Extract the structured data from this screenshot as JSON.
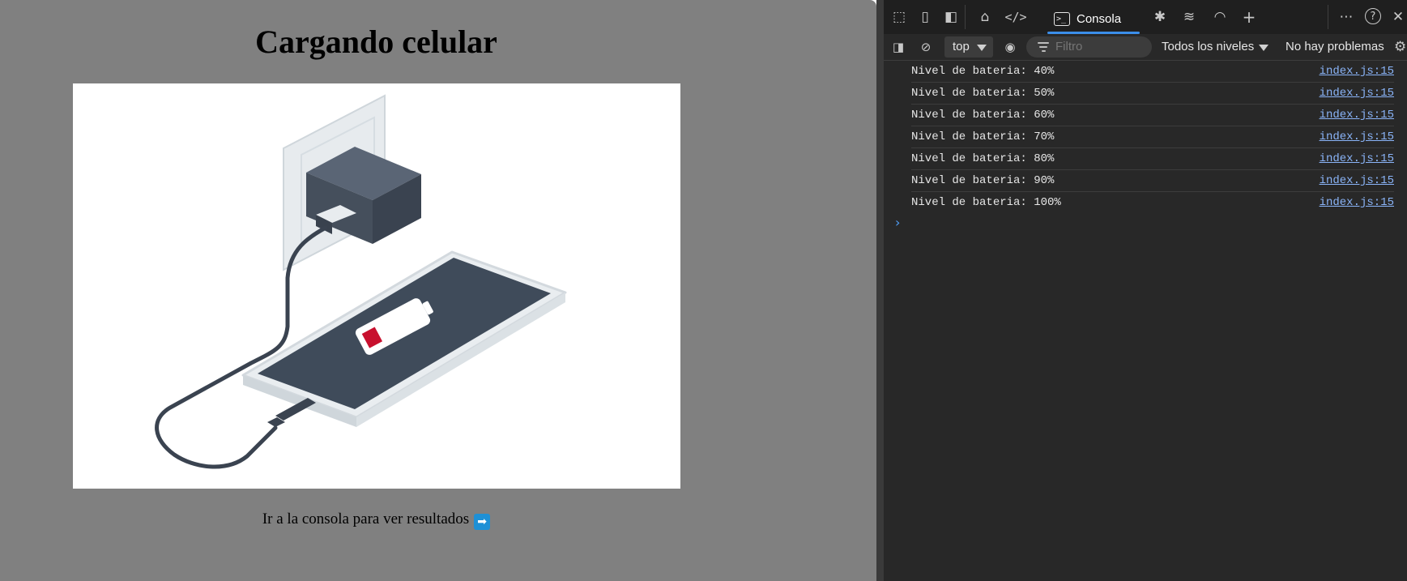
{
  "page": {
    "title": "Cargando celular",
    "hint_text": "Ir a la consola para ver resultados",
    "hint_emoji": "➡"
  },
  "devtools": {
    "console_tab_label": "Consola",
    "context": "top",
    "filter_placeholder": "Filtro",
    "levels_label": "Todos los niveles",
    "issues_label": "No hay problemas",
    "logs": [
      {
        "message": "Nivel de bateria: 40%",
        "source": "index.js:15"
      },
      {
        "message": "Nivel de bateria: 50%",
        "source": "index.js:15"
      },
      {
        "message": "Nivel de bateria: 60%",
        "source": "index.js:15"
      },
      {
        "message": "Nivel de bateria: 70%",
        "source": "index.js:15"
      },
      {
        "message": "Nivel de bateria: 80%",
        "source": "index.js:15"
      },
      {
        "message": "Nivel de bateria: 90%",
        "source": "index.js:15"
      },
      {
        "message": "Nivel de bateria: 100%",
        "source": "index.js:15"
      }
    ],
    "prompt_symbol": "›"
  },
  "colors": {
    "page_background": "#808080",
    "devtools_background": "#282828",
    "accent": "#3b8eea",
    "link": "#8ab4f8",
    "battery_low": "#c8102e"
  },
  "icons": [
    "inspect-icon",
    "device-icon",
    "dock-icon",
    "home-icon",
    "elements-icon",
    "console-icon",
    "bug-icon",
    "wifi-icon",
    "performance-icon",
    "plus-icon",
    "more-icon",
    "help-icon",
    "close-icon",
    "sidebar-icon",
    "clear-icon",
    "eye-icon",
    "filter-icon",
    "gear-icon"
  ]
}
